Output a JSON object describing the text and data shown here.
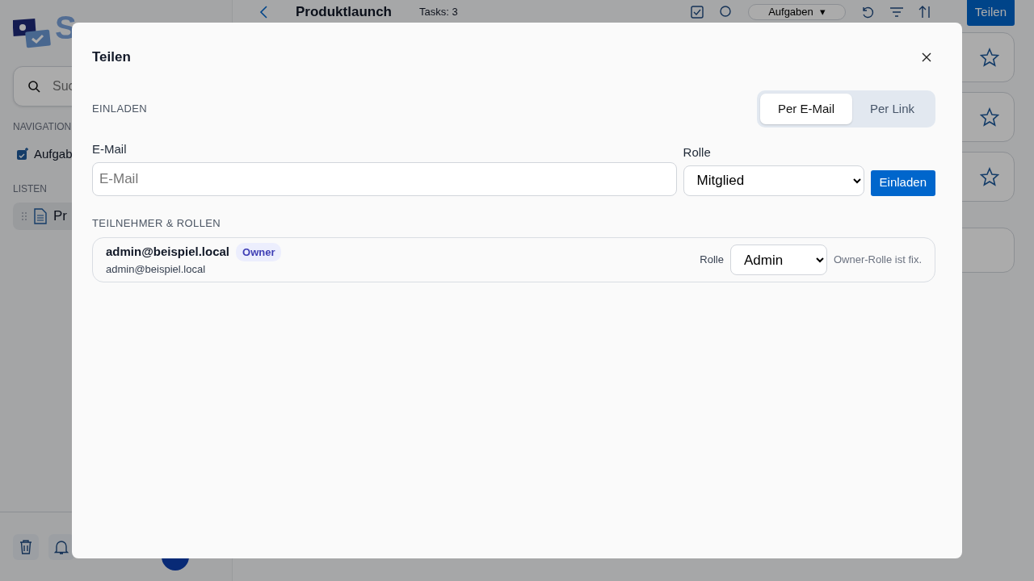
{
  "background": {
    "logo_text": "S",
    "search": {
      "placeholder": "Suc"
    },
    "nav_heading": "NAVIGATION",
    "nav_items": [
      {
        "label": "Aufgab"
      }
    ],
    "lists_heading": "LISTEN",
    "lists": [
      {
        "label": "Pr",
        "selected": true
      }
    ],
    "header": {
      "title": "Produktlaunch",
      "task_count": "Tasks: 3",
      "view_dropdown": "Aufgaben",
      "caret": "▾",
      "share_button": "Teilen"
    },
    "cards": [
      {
        "favorite": false
      },
      {
        "favorite": false
      },
      {
        "favorite": false
      }
    ]
  },
  "modal": {
    "title": "Teilen",
    "invite_heading": "EINLADEN",
    "tabs": [
      {
        "label": "Per E-Mail",
        "selected": true
      },
      {
        "label": "Per Link",
        "selected": false
      }
    ],
    "email_label": "E-Mail",
    "email": {
      "placeholder": "E-Mail"
    },
    "role_label": "Rolle",
    "role_value": "Mitglied",
    "invite_button": "Einladen",
    "participants_heading": "TEILNEHMER & ROLLEN",
    "participants": [
      {
        "name": "admin@beispiel.local",
        "email": "admin@beispiel.local",
        "badge": "Owner",
        "role_label": "Rolle",
        "role": "Admin",
        "note": "Owner-Rolle ist fix."
      }
    ]
  }
}
